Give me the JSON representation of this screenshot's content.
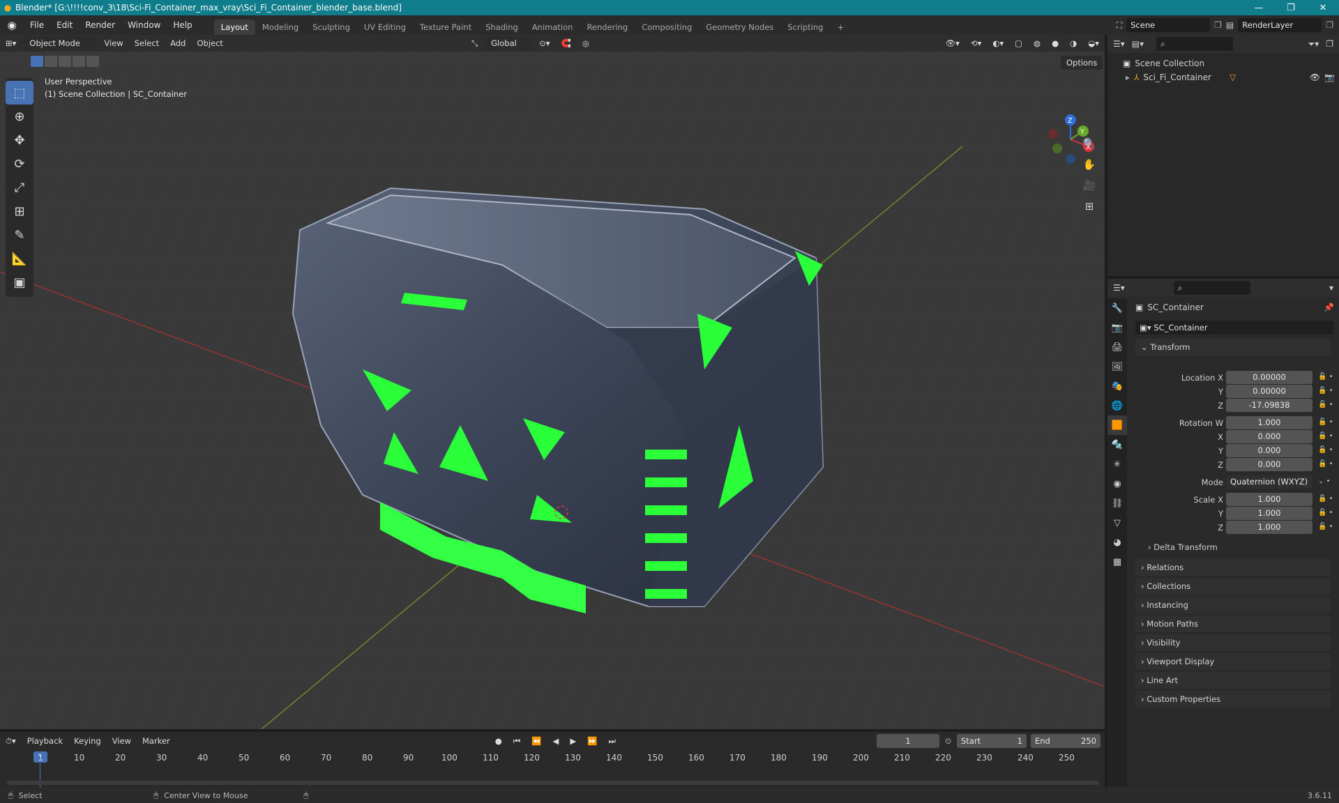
{
  "titlebar": {
    "title": "Blender* [G:\\!!!!conv_3\\18\\Sci-Fi_Container_max_vray\\Sci_Fi_Container_blender_base.blend]",
    "minimize": "—",
    "maximize": "❐",
    "close": "✕"
  },
  "menu": [
    "File",
    "Edit",
    "Render",
    "Window",
    "Help"
  ],
  "workspaces": [
    {
      "label": "Layout",
      "active": true
    },
    {
      "label": "Modeling",
      "active": false
    },
    {
      "label": "Sculpting",
      "active": false
    },
    {
      "label": "UV Editing",
      "active": false
    },
    {
      "label": "Texture Paint",
      "active": false
    },
    {
      "label": "Shading",
      "active": false
    },
    {
      "label": "Animation",
      "active": false
    },
    {
      "label": "Rendering",
      "active": false
    },
    {
      "label": "Compositing",
      "active": false
    },
    {
      "label": "Geometry Nodes",
      "active": false
    },
    {
      "label": "Scripting",
      "active": false
    }
  ],
  "workspace_add": "+",
  "scene": {
    "name": "Scene",
    "render_layer": "RenderLayer"
  },
  "viewport": {
    "mode": "Object Mode",
    "menus": [
      "View",
      "Select",
      "Add",
      "Object"
    ],
    "transform_orientation": "Global",
    "options_label": "Options",
    "overlay_line1": "User Perspective",
    "overlay_line2": "(1) Scene Collection | SC_Container",
    "gizmo": {
      "x": "X",
      "y": "Y",
      "z": "Z"
    }
  },
  "outliner": {
    "root": "Scene Collection",
    "item": "Sci_Fi_Container"
  },
  "properties": {
    "object_name": "SC_Container",
    "data_name": "SC_Container",
    "transform_label": "Transform",
    "location": {
      "label": "Location X",
      "x": "0.00000",
      "y": "0.00000",
      "z": "-17.09838"
    },
    "rotation": {
      "label": "Rotation W",
      "w": "1.000",
      "x": "0.000",
      "y": "0.000",
      "z": "0.000"
    },
    "mode": {
      "label": "Mode",
      "value": "Quaternion (WXYZ)"
    },
    "scale": {
      "label": "Scale X",
      "x": "1.000",
      "y": "1.000",
      "z": "1.000"
    },
    "axis_y": "Y",
    "axis_x": "X",
    "axis_z": "Z",
    "delta_transform": "Delta Transform",
    "panels": [
      "Relations",
      "Collections",
      "Instancing",
      "Motion Paths",
      "Visibility",
      "Viewport Display",
      "Line Art",
      "Custom Properties"
    ]
  },
  "timeline": {
    "menus": [
      "Playback",
      "Keying",
      "View",
      "Marker"
    ],
    "current_frame": "1",
    "start_label": "Start",
    "start": "1",
    "end_label": "End",
    "end": "250",
    "ticks": [
      "1",
      "10",
      "20",
      "30",
      "40",
      "50",
      "60",
      "70",
      "80",
      "90",
      "100",
      "110",
      "120",
      "130",
      "140",
      "150",
      "160",
      "170",
      "180",
      "190",
      "200",
      "210",
      "220",
      "230",
      "240",
      "250"
    ]
  },
  "statusbar": {
    "select": "Select",
    "center": "Center View to Mouse",
    "version": "3.6.11"
  }
}
